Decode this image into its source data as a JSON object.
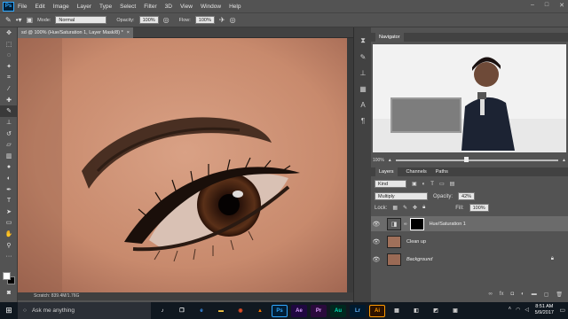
{
  "menu": {
    "app": "Ps",
    "items": [
      "File",
      "Edit",
      "Image",
      "Layer",
      "Type",
      "Select",
      "Filter",
      "3D",
      "View",
      "Window",
      "Help"
    ]
  },
  "options": {
    "mode_label": "Mode:",
    "mode_value": "Normal",
    "opacity_label": "Opacity:",
    "opacity_value": "100%",
    "flow_label": "Flow:",
    "flow_value": "100%"
  },
  "document": {
    "tab_title": "sd @ 100% (Hue/Saturation 1, Layer Mask/8) *",
    "close": "×",
    "status": "Scratch: 839.4M/1.76G"
  },
  "navigator": {
    "title": "Navigator",
    "zoom": "100%"
  },
  "layers": {
    "tabs": [
      "Layers",
      "Channels",
      "Paths"
    ],
    "kind": "Kind",
    "blend": "Multiply",
    "opacity_label": "Opacity:",
    "opacity": "42%",
    "lock_label": "Lock:",
    "fill_label": "Fill:",
    "fill": "100%",
    "rows": [
      {
        "name": "Hue/Saturation 1"
      },
      {
        "name": "Clean up"
      },
      {
        "name": "Background"
      }
    ]
  },
  "taskbar": {
    "search": "Ask me anything",
    "time": "8:51 AM",
    "date": "5/9/2017",
    "apps": [
      {
        "label": "Ps",
        "color": "#31a8ff",
        "bg": "#001e36"
      },
      {
        "label": "Ae",
        "color": "#d8a1ff",
        "bg": "#1f0740"
      },
      {
        "label": "Pr",
        "color": "#e0a0ff",
        "bg": "#2a0a3c"
      },
      {
        "label": "Au",
        "color": "#00e4bb",
        "bg": "#00281f"
      },
      {
        "label": "Lr",
        "color": "#5fb4ff",
        "bg": "#001a2e"
      },
      {
        "label": "Ai",
        "color": "#ff9a00",
        "bg": "#2e1300"
      }
    ]
  },
  "colors": {
    "accent": "#31a8ff",
    "selected_layer": "#6b6b6b"
  }
}
